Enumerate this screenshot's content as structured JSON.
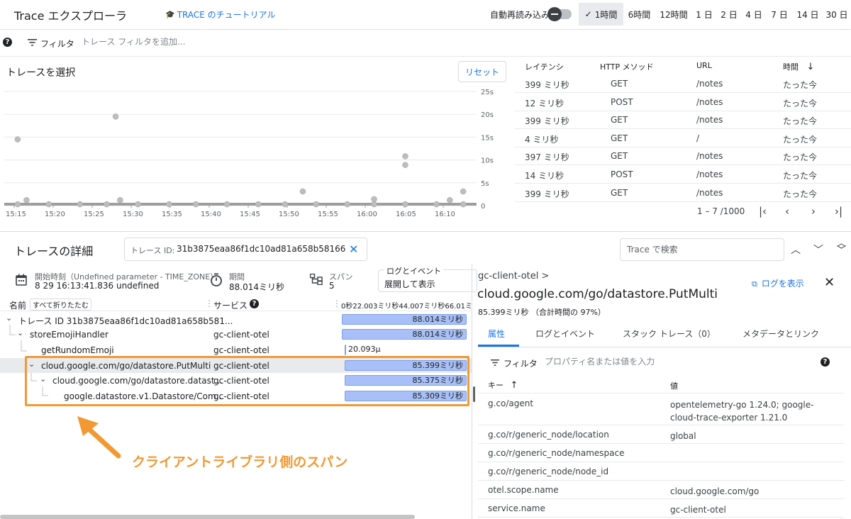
{
  "header": {
    "title": "Trace エクスプローラ",
    "tutorial": "TRACE のチュートリアル",
    "auto_reload": "自動再読み込み",
    "time_ranges": [
      {
        "label": "1時間",
        "selected": true
      },
      {
        "label": "6時間"
      },
      {
        "label": "12時間"
      },
      {
        "label": "1 日"
      },
      {
        "label": "2 日"
      },
      {
        "label": "4 日"
      },
      {
        "label": "7 日"
      },
      {
        "label": "14 日"
      },
      {
        "label": "30 日"
      }
    ],
    "check_mark": "✓"
  },
  "filter": {
    "help": "?",
    "label": "フィルタ",
    "placeholder": "トレース フィルタを追加..."
  },
  "scatter": {
    "title": "トレースを選択",
    "reset": "リセット"
  },
  "chart_data": {
    "type": "scatter",
    "y_ticks": [
      "25s",
      "20s",
      "15s",
      "10s",
      "5s",
      "0"
    ],
    "x_ticks": [
      "15:15",
      "15:20",
      "15:25",
      "15:30",
      "15:35",
      "15:40",
      "15:45",
      "15:50",
      "15:55",
      "16:00",
      "16:05",
      "16:10"
    ],
    "ylim": [
      0,
      25
    ],
    "xlim": [
      15.1,
      16.16
    ],
    "grid": true,
    "points": [
      [
        15.13,
        14.5
      ],
      [
        15.35,
        19.5
      ],
      [
        16.0,
        10.8
      ],
      [
        16.0,
        8.9
      ],
      [
        15.77,
        3.1
      ],
      [
        16.13,
        3.1
      ],
      [
        15.36,
        1.2
      ],
      [
        15.93,
        1.4
      ],
      [
        15.15,
        1.2
      ],
      [
        16.1,
        1.2
      ],
      [
        15.13,
        0.3
      ],
      [
        15.2,
        0.3
      ],
      [
        15.27,
        0.3
      ],
      [
        15.33,
        0.3
      ],
      [
        15.4,
        0.3
      ],
      [
        15.47,
        0.3
      ],
      [
        15.53,
        0.3
      ],
      [
        15.6,
        0.3
      ],
      [
        15.67,
        0.3
      ],
      [
        15.73,
        0.3
      ],
      [
        15.8,
        0.3
      ],
      [
        15.87,
        0.3
      ],
      [
        15.93,
        0.3
      ],
      [
        16.0,
        0.3
      ],
      [
        16.07,
        0.3
      ],
      [
        16.13,
        0.3
      ]
    ],
    "point_color": "#bdbdbd",
    "baseline_color": "#9e9e9e"
  },
  "trace_list": {
    "headers": [
      "レイテンシ",
      "HTTP メソッド",
      "URL",
      "時間"
    ],
    "sort_arrow": "↓",
    "rows": [
      [
        "399 ミリ秒",
        "GET",
        "/notes",
        "たった今"
      ],
      [
        "12 ミリ秒",
        "POST",
        "/notes",
        "たった今"
      ],
      [
        "399 ミリ秒",
        "GET",
        "/notes",
        "たった今"
      ],
      [
        "4 ミリ秒",
        "GET",
        "/",
        "たった今"
      ],
      [
        "397 ミリ秒",
        "GET",
        "/notes",
        "たった今"
      ],
      [
        "14 ミリ秒",
        "POST",
        "/notes",
        "たった今"
      ],
      [
        "399 ミリ秒",
        "GET",
        "/notes",
        "たった今"
      ]
    ],
    "pager": "1 – 7 /1000",
    "pager_buttons": [
      "|‹",
      "‹",
      "›",
      "›|"
    ]
  },
  "details": {
    "title": "トレースの詳細",
    "trace_id_label": "トレース ID:",
    "trace_id": "31b3875eaa86f1dc10ad81a658b58166",
    "search_placeholder": "Trace で検索",
    "start_label": "開始時刻（Undefined parameter - TIME_ZONE）",
    "start_value": "8 29 16:13:41.836 undefined",
    "duration_label": "期間",
    "duration_value": "88.014ミリ秒",
    "spans_label": "スパン",
    "spans_value": "5",
    "log_events_label": "ログとイベント",
    "log_events_value": "展開して表示"
  },
  "span_table": {
    "name_header": "名前",
    "collapse_all": "すべて折りたたむ",
    "service_header": "サービス",
    "service_help": "?",
    "timeline_header": "0秒22.003ミリ秒44.007ミリ秒66.01ミ",
    "rows": [
      {
        "name": "トレース ID 31b3875eaa86f1dc10ad81a658b581...",
        "service": "",
        "bar": "88.014ミリ秒"
      },
      {
        "name": "storeEmojiHandler",
        "service": "gc-client-otel",
        "bar": "88.014ミリ秒"
      },
      {
        "name": "getRundomEmoji",
        "service": "gc-client-otel",
        "bar": "20.093μ"
      },
      {
        "name": "cloud.google.com/go/datastore.PutMulti",
        "service": "gc-client-otel",
        "bar": "85.399ミリ秒"
      },
      {
        "name": "cloud.google.com/go/datastore.datast...",
        "service": "gc-client-otel",
        "bar": "85.375ミリ秒"
      },
      {
        "name": "google.datastore.v1.Datastore/Com...",
        "service": "gc-client-otel",
        "bar": "85.309ミリ秒"
      }
    ]
  },
  "annotation": {
    "callout": "クライアントライブラリ側のスパン"
  },
  "span_panel": {
    "breadcrumb": "gc-client-otel >",
    "title": "cloud.google.com/go/datastore.PutMulti",
    "duration": "85.399ミリ秒 （合計時間の 97%）",
    "view_logs": "ログを表示",
    "close": "✕",
    "tabs": [
      "属性",
      "ログとイベント",
      "スタック トレース（0）",
      "メタデータとリンク"
    ],
    "filter_label": "フィルタ",
    "filter_placeholder": "プロパティ名または値を入力",
    "key_header": "キー",
    "value_header": "値",
    "props": [
      {
        "key": "g.co/agent",
        "value": "opentelemetry-go 1.24.0; google-cloud-trace-exporter 1.21.0"
      },
      {
        "key": "g.co/r/generic_node/location",
        "value": "global"
      },
      {
        "key": "g.co/r/generic_node/namespace",
        "value": ""
      },
      {
        "key": "g.co/r/generic_node/node_id",
        "value": ""
      },
      {
        "key": "otel.scope.name",
        "value": "cloud.google.com/go"
      },
      {
        "key": "service.name",
        "value": "gc-client-otel"
      }
    ]
  },
  "colors": {
    "accent": "#1a73e8",
    "highlight": "#f29933",
    "bar": "#a8c0f7"
  }
}
